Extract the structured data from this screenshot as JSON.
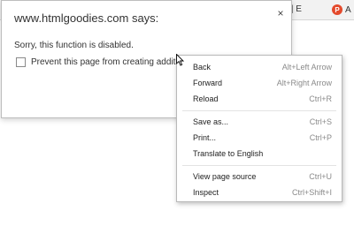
{
  "browser": {
    "tab_partial_1": "rature | E",
    "tab_separator": "|",
    "tab_partial_2": "A",
    "tab2_icon_letter": "P"
  },
  "dialog": {
    "title": "www.htmlgoodies.com says:",
    "message": "Sorry, this function is disabled.",
    "checkbox_label": "Prevent this page from creating additional",
    "close_symbol": "×"
  },
  "context_menu": {
    "items": [
      {
        "label": "Back",
        "shortcut": "Alt+Left Arrow"
      },
      {
        "label": "Forward",
        "shortcut": "Alt+Right Arrow"
      },
      {
        "label": "Reload",
        "shortcut": "Ctrl+R"
      },
      {
        "label": "Save as...",
        "shortcut": "Ctrl+S"
      },
      {
        "label": "Print...",
        "shortcut": "Ctrl+P"
      },
      {
        "label": "Translate to English",
        "shortcut": ""
      },
      {
        "label": "View page source",
        "shortcut": "Ctrl+U"
      },
      {
        "label": "Inspect",
        "shortcut": "Ctrl+Shift+I"
      }
    ]
  },
  "colors": {
    "tab_icon_bg": "#e44a2c",
    "shortcut_text": "#8a8a8a"
  }
}
